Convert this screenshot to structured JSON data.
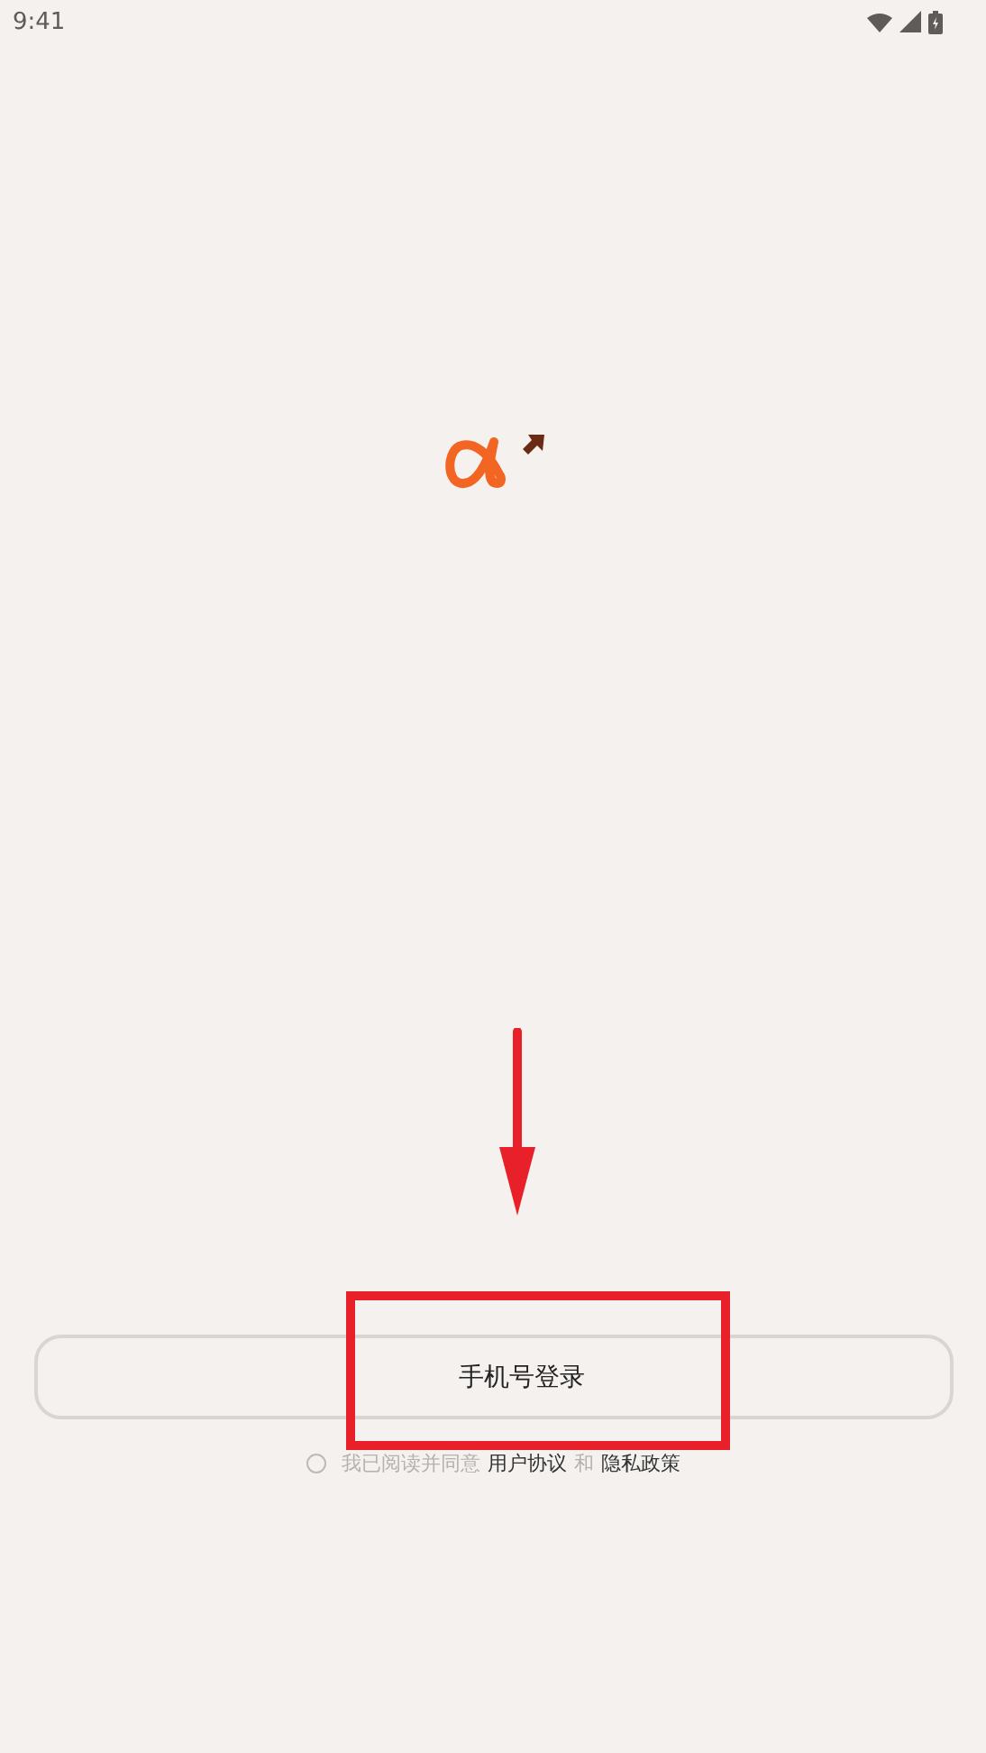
{
  "status_bar": {
    "time": "9:41"
  },
  "login_button": {
    "label": "手机号登录"
  },
  "agreement": {
    "checked": false,
    "prefix": "我已阅读并同意",
    "links": [
      "用户协议",
      "隐私政策"
    ],
    "joiner": "和"
  }
}
